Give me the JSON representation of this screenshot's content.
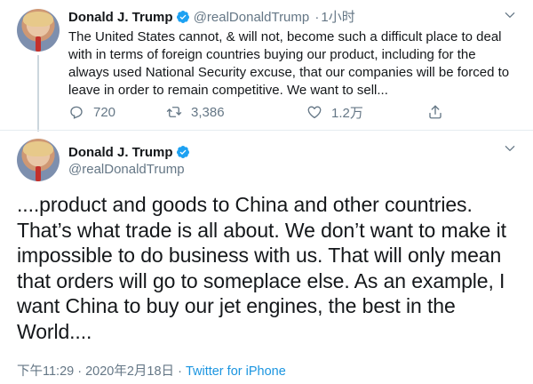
{
  "colors": {
    "text": "#14171a",
    "secondary": "#657786",
    "link": "#1b95e0",
    "verified": "#1da1f2"
  },
  "tweet1": {
    "name": "Donald J. Trump",
    "handle": "@realDonaldTrump",
    "separator": "·",
    "time": "1小时",
    "text": "The United States cannot, & will not, become such a difficult place to deal with in terms of foreign countries buying our product, including for the always used National Security excuse, that our companies will be forced to leave in order to remain competitive. We want to sell...",
    "reply_count": "720",
    "retweet_count": "3,386",
    "like_count": "1.2万",
    "icons": [
      "reply-icon",
      "retweet-icon",
      "like-icon",
      "share-icon",
      "chevron-down-icon",
      "verified-icon"
    ]
  },
  "tweet2": {
    "name": "Donald J. Trump",
    "handle": "@realDonaldTrump",
    "text": "....product and goods to China and other countries. That’s what trade is all about. We don’t want to make it impossible to do business with us. That will only mean that orders will go to someplace else. As an example, I want China to buy our jet engines, the best in the World....",
    "timestamp": "下午11:29 · 2020年2月18日",
    "separator": " · ",
    "source": "Twitter for iPhone"
  }
}
